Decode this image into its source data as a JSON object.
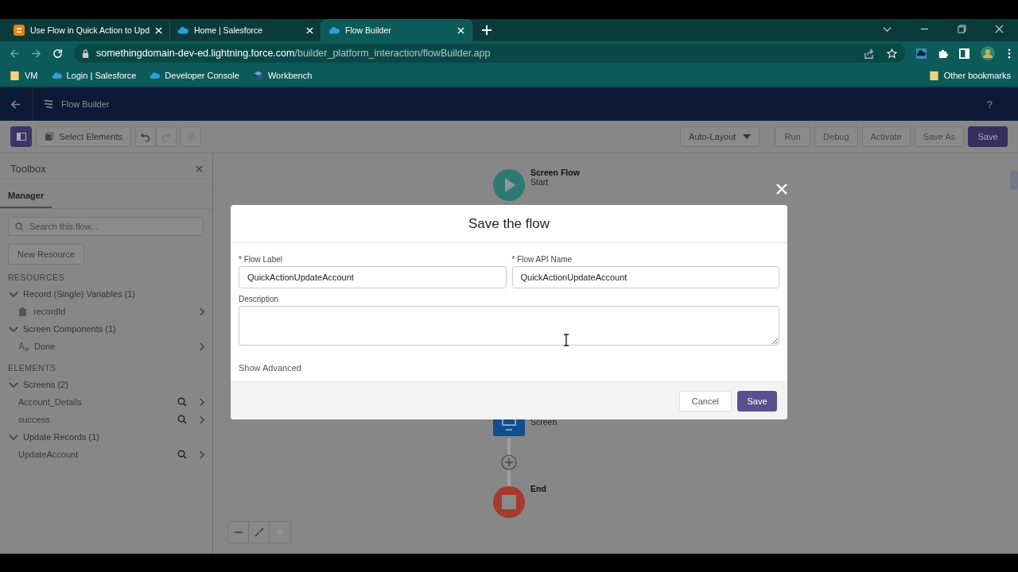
{
  "browser": {
    "tabs": [
      {
        "title": "Use Flow in Quick Action to Upd",
        "kind": "blog",
        "selected": false
      },
      {
        "title": "Home | Salesforce",
        "kind": "cloud",
        "selected": false
      },
      {
        "title": "Flow Builder",
        "kind": "cloud",
        "selected": true
      }
    ],
    "url": {
      "domain": "somethingdomain-dev-ed.lightning.force.com",
      "path": "/builder_platform_interaction/flowBuilder.app"
    },
    "bookmarks": [
      {
        "label": "VM",
        "kind": "folder"
      },
      {
        "label": "Login | Salesforce",
        "kind": "cloud"
      },
      {
        "label": "Developer Console",
        "kind": "cloud"
      },
      {
        "label": "Workbench",
        "kind": "cube"
      }
    ],
    "other_bookmarks": "Other bookmarks"
  },
  "app": {
    "title": "Flow Builder",
    "help": "?"
  },
  "toolbar": {
    "select_elements": "Select Elements",
    "undo_disabled": false,
    "redo_disabled": true,
    "layout": "Auto-Layout",
    "actions": [
      {
        "label": "Run",
        "disabled": true,
        "primary": false
      },
      {
        "label": "Debug",
        "disabled": true,
        "primary": false
      },
      {
        "label": "Activate",
        "disabled": true,
        "primary": false
      },
      {
        "label": "Save As",
        "disabled": true,
        "primary": false
      },
      {
        "label": "Save",
        "disabled": false,
        "primary": true
      }
    ]
  },
  "toolbox": {
    "title": "Toolbox",
    "tabs": [
      {
        "label": "Manager",
        "selected": true
      }
    ],
    "search_placeholder": "Search this flow...",
    "new_resource": "New Resource",
    "sections": [
      {
        "heading": "RESOURCES",
        "groups": [
          {
            "label": "Record (Single) Variables (1)",
            "expanded": true,
            "children": [
              {
                "label": "recordId",
                "kind": "variable"
              }
            ]
          },
          {
            "label": "Screen Components (1)",
            "expanded": true,
            "children": [
              {
                "label": "Done",
                "kind": "component"
              }
            ]
          }
        ]
      },
      {
        "heading": "ELEMENTS",
        "groups": [
          {
            "label": "Screens (2)",
            "expanded": true,
            "children": [
              {
                "label": "Account_Details",
                "kind": "element"
              },
              {
                "label": "success",
                "kind": "element"
              }
            ]
          },
          {
            "label": "Update Records (1)",
            "expanded": true,
            "children": [
              {
                "label": "UpdateAccount",
                "kind": "element"
              }
            ]
          }
        ]
      }
    ]
  },
  "canvas": {
    "start": {
      "title": "Screen Flow",
      "subtitle": "Start"
    },
    "screen": {
      "label": "Screen"
    },
    "end": {
      "label": "End"
    }
  },
  "modal": {
    "title": "Save the flow",
    "fields": [
      {
        "label": "* Flow Label",
        "value": "QuickActionUpdateAccount"
      },
      {
        "label": "* Flow API Name",
        "value": "QuickActionUpdateAccount"
      }
    ],
    "description": {
      "label": "Description"
    },
    "show_advanced": "Show Advanced",
    "buttons": [
      {
        "label": "Cancel",
        "kind": "neutral"
      },
      {
        "label": "Save",
        "kind": "brand"
      }
    ]
  }
}
